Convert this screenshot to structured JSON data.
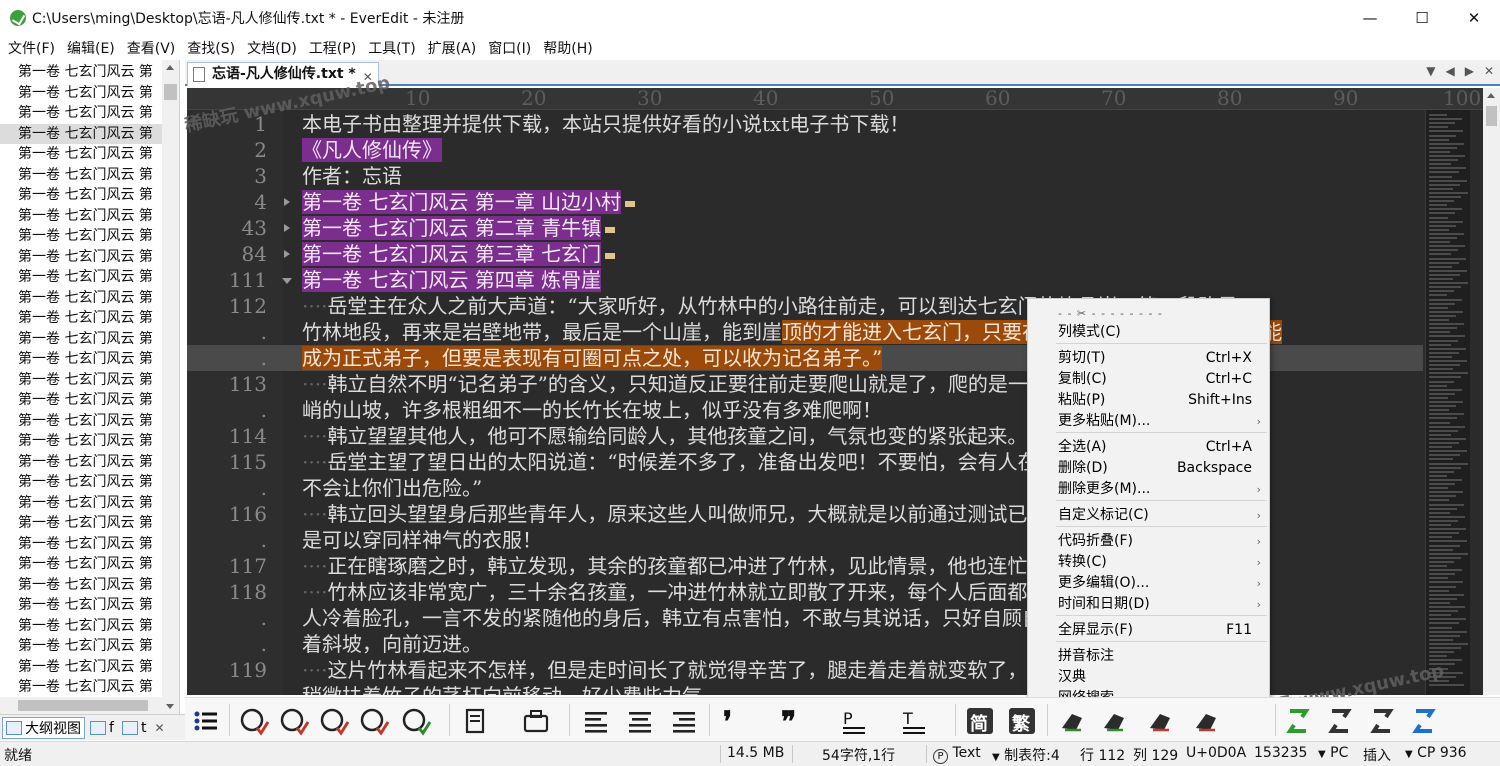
{
  "window": {
    "title": "C:\\Users\\ming\\Desktop\\忘语-凡人修仙传.txt * - EverEdit - 未注册",
    "minimize": "—",
    "maximize": "☐",
    "close": "✕"
  },
  "menu": [
    "文件(F)",
    "编辑(E)",
    "查看(V)",
    "查找(S)",
    "文档(D)",
    "工程(P)",
    "工具(T)",
    "扩展(A)",
    "窗口(I)",
    "帮助(H)"
  ],
  "outline": {
    "items": [
      "第一卷 七玄门风云 第",
      "第一卷 七玄门风云 第",
      "第一卷 七玄门风云 第",
      "第一卷 七玄门风云 第",
      "第一卷 七玄门风云 第",
      "第一卷 七玄门风云 第",
      "第一卷 七玄门风云 第",
      "第一卷 七玄门风云 第",
      "第一卷 七玄门风云 第",
      "第一卷 七玄门风云 第",
      "第一卷 七玄门风云 第",
      "第一卷 七玄门风云 第",
      "第一卷 七玄门风云 第",
      "第一卷 七玄门风云 第",
      "第一卷 七玄门风云 第",
      "第一卷 七玄门风云 第",
      "第一卷 七玄门风云 第",
      "第一卷 七玄门风云 第",
      "第一卷 七玄门风云 第",
      "第一卷 七玄门风云 第",
      "第一卷 七玄门风云 第",
      "第一卷 七玄门风云 第",
      "第一卷 七玄门风云 第",
      "第一卷 七玄门风云 第",
      "第一卷 七玄门风云 第",
      "第一卷 七玄门风云 第",
      "第一卷 七玄门风云 第",
      "第一卷 七玄门风云 第",
      "第一卷 七玄门风云 第",
      "第一卷 七玄门风云 第",
      "第一卷 七玄门风云 第"
    ],
    "selected_index": 3,
    "tab_active": "大纲视图",
    "tab2": "f",
    "tab3": "t",
    "close": "✕"
  },
  "document_tab": {
    "label": "忘语-凡人修仙传.txt *",
    "close": "✕",
    "controls": [
      "▼",
      "◀",
      "▶",
      "✕"
    ]
  },
  "ruler": [
    "10",
    "20",
    "30",
    "40",
    "50",
    "60",
    "70",
    "80",
    "90",
    "100"
  ],
  "editor": {
    "lines": [
      {
        "ln": "1",
        "fold": "",
        "segments": [
          {
            "t": "本电子书由整理并提供下载，本站只提供好看的小说txt电子书下载！",
            "c": ""
          }
        ]
      },
      {
        "ln": "2",
        "fold": "",
        "segments": [
          {
            "t": "《凡人修仙传》",
            "c": "purple"
          }
        ]
      },
      {
        "ln": "3",
        "fold": "",
        "segments": [
          {
            "t": "作者：忘语",
            "c": ""
          }
        ]
      },
      {
        "ln": "4",
        "fold": "closed",
        "segments": [
          {
            "t": "第一卷 七玄门风云 第一章 山边小村",
            "c": "purple"
          }
        ]
      },
      {
        "ln": "43",
        "fold": "closed",
        "segments": [
          {
            "t": "第一卷 七玄门风云 第二章 青牛镇",
            "c": "purple"
          }
        ]
      },
      {
        "ln": "84",
        "fold": "closed",
        "segments": [
          {
            "t": "第一卷 七玄门风云 第三章 七玄门",
            "c": "purple"
          }
        ]
      },
      {
        "ln": "111",
        "fold": "open",
        "segments": [
          {
            "t": "第一卷 七玄门风云 第四章 炼骨崖",
            "c": "purple"
          }
        ]
      },
      {
        "ln": "112",
        "fold": "",
        "segments": [
          {
            "t": "····",
            "c": "dots"
          },
          {
            "t": "岳堂主在众人之前大声道：“大家听好，从竹林中的小路往前走，可以到达七玄门的炼骨崖，第一段路是",
            "c": ""
          }
        ]
      },
      {
        "ln": ".",
        "fold": "",
        "segments": [
          {
            "t": "竹林地段，再来是岩壁地带，最后是一个山崖，能到崖",
            "c": ""
          },
          {
            "t": "顶的才能进入七玄门，只要在中午之前能到达，虽然不能",
            "c": "orange"
          }
        ]
      },
      {
        "ln": ".",
        "fold": "",
        "cur": true,
        "segments": [
          {
            "t": "成为正式弟子，但要是表现有可圈可点之处，可以收为记名弟子。”",
            "c": "orange"
          }
        ]
      },
      {
        "ln": "113",
        "fold": "",
        "segments": [
          {
            "t": "····",
            "c": "dots"
          },
          {
            "t": "韩立自然不明“记名弟子”的含义，只知道反正要往前走要爬山就是了，爬的是一面不算陡",
            "c": ""
          }
        ]
      },
      {
        "ln": ".",
        "fold": "",
        "segments": [
          {
            "t": "峭的山坡，许多根粗细不一的长竹长在坡上，似乎没有多难爬啊！",
            "c": ""
          }
        ]
      },
      {
        "ln": "114",
        "fold": "",
        "segments": [
          {
            "t": "····",
            "c": "dots"
          },
          {
            "t": "韩立望望其他人，他可不愿输给同龄人，其他孩童之间，气氛也变的紧张起来。",
            "c": ""
          }
        ]
      },
      {
        "ln": "115",
        "fold": "",
        "segments": [
          {
            "t": "····",
            "c": "dots"
          },
          {
            "t": "岳堂主望了望日出的太阳说道：“时候差不多了，准备出发吧！不要怕，会有人在后面护住你们的，",
            "c": ""
          }
        ]
      },
      {
        "ln": ".",
        "fold": "",
        "segments": [
          {
            "t": "不会让你们出危险。”",
            "c": ""
          }
        ]
      },
      {
        "ln": "116",
        "fold": "",
        "segments": [
          {
            "t": "····",
            "c": "dots"
          },
          {
            "t": "韩立回头望望身后那些青年人，原来这些人叫做师兄，大概就是以前通过测试已经加入了，是不",
            "c": ""
          }
        ]
      },
      {
        "ln": ".",
        "fold": "",
        "segments": [
          {
            "t": "是可以穿同样神气的衣服！",
            "c": ""
          }
        ]
      },
      {
        "ln": "117",
        "fold": "",
        "segments": [
          {
            "t": "····",
            "c": "dots"
          },
          {
            "t": "正在瞎琢磨之时，韩立发现，其余的孩童都已冲进了竹林，见此情景，他也连忙跟上。",
            "c": ""
          }
        ]
      },
      {
        "ln": "118",
        "fold": "",
        "segments": [
          {
            "t": "····",
            "c": "dots"
          },
          {
            "t": "竹林应该非常宽广，三十余名孩童，一冲进竹林就立即散了开来，每个人后面都跟着一个年长的师兄，这",
            "c": ""
          }
        ]
      },
      {
        "ln": ".",
        "fold": "",
        "segments": [
          {
            "t": "人冷着脸孔，一言不发的紧随他的身后，韩立有点害怕，不敢与其说话，只好自顾自的踩着竹子，慢慢的沿",
            "c": ""
          }
        ]
      },
      {
        "ln": ".",
        "fold": "",
        "segments": [
          {
            "t": "着斜坡，向前迈进。",
            "c": ""
          }
        ]
      },
      {
        "ln": "119",
        "fold": "",
        "segments": [
          {
            "t": "····",
            "c": "dots"
          },
          {
            "t": "这片竹林看起来不怎样，但是走时间长了就觉得辛苦了，腿走着走着就变软了，现在必须用一只手",
            "c": ""
          }
        ]
      },
      {
        "ln": ".",
        "fold": "",
        "segments": [
          {
            "t": "稍微扶着竹子的茎杆向前移动，好少费些力气。",
            "c": ""
          }
        ]
      }
    ]
  },
  "context_menu": {
    "top_separator": "- - ✂ - - - - - - - -",
    "items": [
      {
        "label": "列模式(C)",
        "shortcut": "",
        "sub": false
      },
      {
        "label": "剪切(T)",
        "shortcut": "Ctrl+X",
        "sub": false
      },
      {
        "label": "复制(C)",
        "shortcut": "Ctrl+C",
        "sub": false
      },
      {
        "label": "粘贴(P)",
        "shortcut": "Shift+Ins",
        "sub": false
      },
      {
        "label": "更多粘贴(M)...",
        "shortcut": "",
        "sub": true
      },
      {
        "label": "全选(A)",
        "shortcut": "Ctrl+A",
        "sub": false
      },
      {
        "label": "删除(D)",
        "shortcut": "Backspace",
        "sub": false
      },
      {
        "label": "删除更多(M)...",
        "shortcut": "",
        "sub": true
      },
      {
        "label": "自定义标记(C)",
        "shortcut": "",
        "sub": true
      },
      {
        "label": "代码折叠(F)",
        "shortcut": "",
        "sub": true
      },
      {
        "label": "转换(C)",
        "shortcut": "",
        "sub": true
      },
      {
        "label": "更多编辑(O)...",
        "shortcut": "",
        "sub": true
      },
      {
        "label": "时间和日期(D)",
        "shortcut": "",
        "sub": true
      },
      {
        "label": "全屏显示(F)",
        "shortcut": "F11",
        "sub": false
      },
      {
        "label": "拼音标注",
        "shortcut": "",
        "sub": false
      },
      {
        "label": "汉典",
        "shortcut": "",
        "sub": false
      },
      {
        "label": "网络搜索",
        "shortcut": "",
        "sub": false
      }
    ],
    "sub_arrow": "›"
  },
  "toolbar": {
    "icons": [
      "list-bullets-icon",
      "spell-check-icon",
      "grammar-check-icon",
      "question-check-icon",
      "text-check-icon",
      "lines-check-icon",
      "document-icon",
      "briefcase-icon",
      "outdent-icon",
      "align-center-icon",
      "indent-icon",
      "single-quote-icon",
      "double-quote-icon",
      "paragraph-format-icon",
      "text-format-icon",
      "simplified-chinese-icon",
      "traditional-chinese-icon",
      "convert-s-icon",
      "convert-r-icon",
      "convert-a-icon",
      "convert-e-icon",
      "recycle-s-icon",
      "recycle-t-icon",
      "recycle-f-icon",
      "recycle-r-icon"
    ],
    "label_simplified": "简",
    "label_traditional": "繁"
  },
  "statusbar": {
    "ready": "就绪",
    "size": "14.5 MB",
    "chars": "54字符,1行",
    "mode": "Text",
    "tab": "制表符:4",
    "row": "行 112",
    "col": "列 129",
    "code": "U+0D0A",
    "offset": "153235",
    "eol": "PC",
    "insert": "插入",
    "cp": "CP 936"
  },
  "watermark": "稀缺玩 www.xquw.top",
  "colors": {
    "editor_bg": "#2b2b2b",
    "purple_highlight": "#7b2e8e",
    "orange_highlight": "#9b4a0a",
    "accent_blue": "#4a7fc1"
  }
}
